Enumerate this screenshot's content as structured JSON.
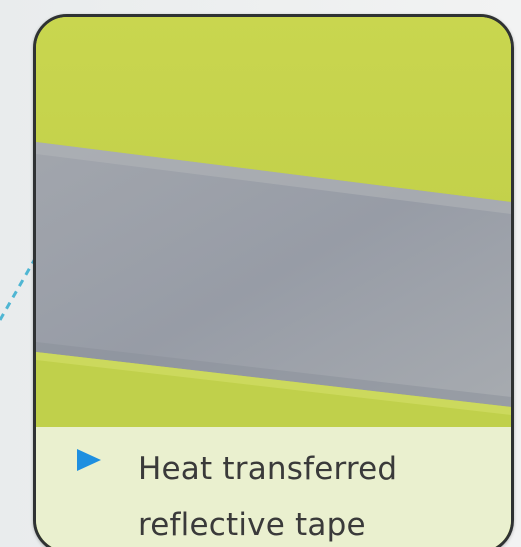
{
  "caption": {
    "text": "Heat transferred reflective tape",
    "bullet_icon": "blue-triangle-bullet-icon"
  },
  "colors": {
    "fabric_green": "#c3d24a",
    "tape_gray": "#9da3ad",
    "caption_bg": "#eaf0cf",
    "bullet_blue": "#1e8fe0",
    "border": "#2f3233"
  }
}
